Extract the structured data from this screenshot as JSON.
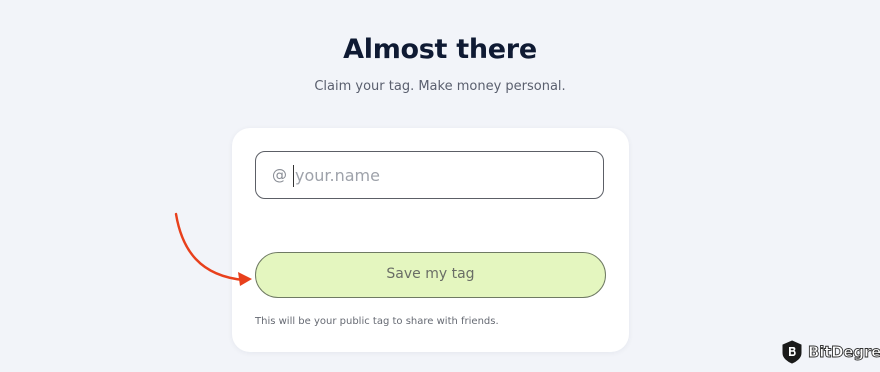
{
  "page": {
    "title": "Almost there",
    "subtitle": "Claim your tag. Make money personal."
  },
  "form": {
    "at_symbol": "@",
    "tag_input": {
      "value": "",
      "placeholder": "your.name"
    },
    "save_button_label": "Save my tag",
    "hint": "This will be your public tag to share with friends."
  },
  "annotation": {
    "arrow_icon": "curved-arrow-icon",
    "arrow_color": "#e8401c"
  },
  "watermark": {
    "logo_icon": "bitdegree-shield-icon",
    "text": "BitDegree"
  },
  "colors": {
    "background": "#f2f4f9",
    "button_fill": "#e4f6bf",
    "title": "#0f1a33"
  }
}
